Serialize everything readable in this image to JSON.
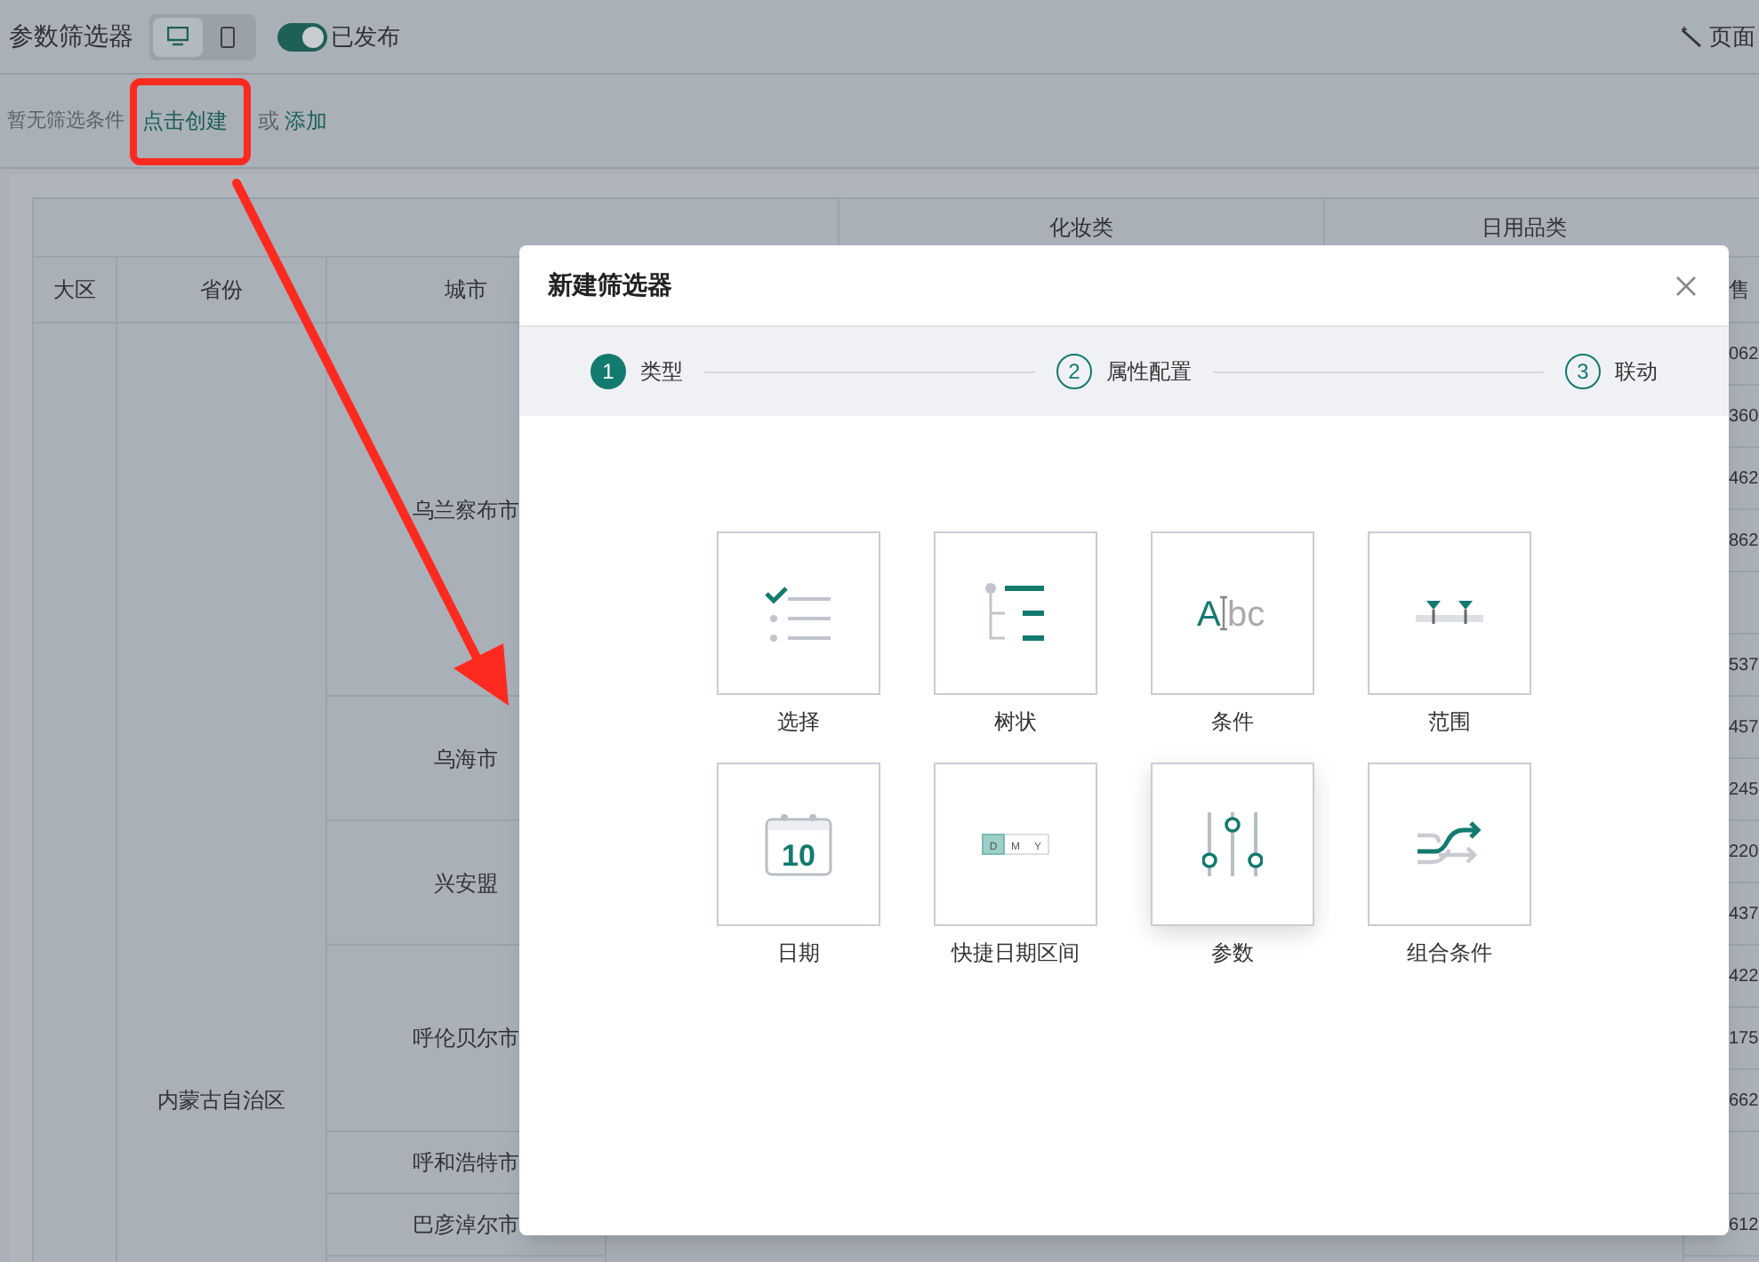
{
  "toolbar": {
    "title": "参数筛选器",
    "view_modes": [
      {
        "kind": "desktop",
        "selected": true
      },
      {
        "kind": "mobile",
        "selected": false
      }
    ],
    "publish_toggle": {
      "on": true,
      "label": "已发布"
    },
    "right_action": "页面"
  },
  "filter_bar": {
    "empty_text": "暂无筛选条件",
    "create_link": "点击创建",
    "or_text": "或",
    "add_link": "添加"
  },
  "table": {
    "group_headers": [
      "化妆类",
      "日用品类"
    ],
    "columns": [
      "大区",
      "省份",
      "城市"
    ],
    "last_column": "售",
    "province": "内蒙古自治区",
    "cities": [
      {
        "name": "乌兰察布市"
      },
      {
        "name": "乌海市"
      },
      {
        "name": "兴安盟"
      },
      {
        "name": "呼伦贝尔市"
      },
      {
        "name": "呼和浩特市"
      },
      {
        "name": "巴彦淖尔市"
      }
    ],
    "last_column_cells": [
      {
        "text": "062"
      },
      {
        "text": "360"
      },
      {
        "text": "462"
      },
      {
        "text": "862"
      },
      {},
      {
        "text": "537"
      },
      {
        "text": "457"
      },
      {
        "text": "245"
      },
      {
        "text": "220"
      },
      {
        "text": "437"
      },
      {
        "text": "422"
      },
      {
        "text": "175"
      },
      {
        "text": "662"
      },
      {},
      {
        "text": "612"
      }
    ]
  },
  "dialog": {
    "title": "新建筛选器",
    "steps": [
      {
        "number": "1",
        "label": "类型",
        "selected": true
      },
      {
        "number": "2",
        "label": "属性配置",
        "selected": false
      },
      {
        "number": "3",
        "label": "联动",
        "selected": false
      }
    ],
    "types": [
      {
        "kind": "select",
        "label": "选择",
        "selected": false
      },
      {
        "kind": "tree",
        "label": "树状",
        "selected": false
      },
      {
        "kind": "condition",
        "label": "条件",
        "icon_text": [
          "A",
          "bc"
        ],
        "selected": false
      },
      {
        "kind": "range",
        "label": "范围",
        "selected": false
      },
      {
        "kind": "date",
        "label": "日期",
        "icon_text": [
          "10"
        ],
        "selected": false
      },
      {
        "kind": "quick_date",
        "label": "快捷日期区间",
        "icon_text": [
          "D",
          "M",
          "Y"
        ],
        "selected": false
      },
      {
        "kind": "parameter",
        "label": "参数",
        "selected": true
      },
      {
        "kind": "combined",
        "label": "组合条件",
        "selected": false
      }
    ]
  }
}
